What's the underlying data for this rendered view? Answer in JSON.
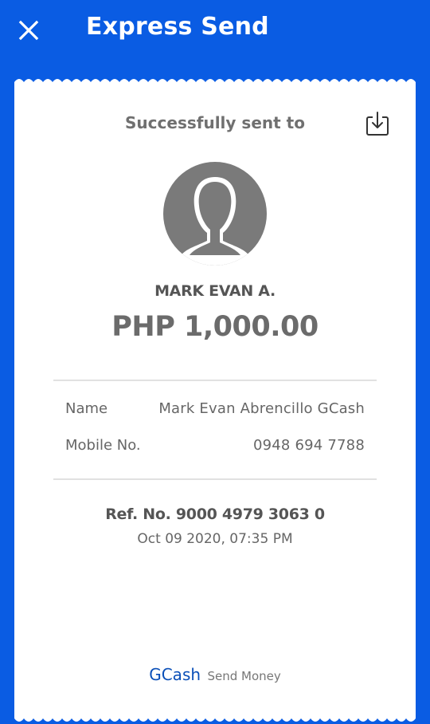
{
  "header": {
    "title": "Express Send"
  },
  "receipt": {
    "heading": "Successfully sent to",
    "recipient_short": "MARK EVAN A.",
    "amount": "PHP 1,000.00",
    "details": [
      {
        "label": "Name",
        "value": "Mark Evan Abrencillo GCash"
      },
      {
        "label": "Mobile No.",
        "value": "0948 694 7788"
      }
    ],
    "reference": "Ref. No. 9000 4979 3063 0",
    "datetime": "Oct 09 2020, 07:35 PM",
    "footer": {
      "brand": "GCash",
      "caption": "Send Money"
    }
  },
  "colors": {
    "brand_blue": "#0a5ce3",
    "text_gray": "#6b6b6b"
  },
  "icons": {
    "close": "close-icon",
    "download": "download-icon",
    "avatar": "avatar-placeholder"
  }
}
